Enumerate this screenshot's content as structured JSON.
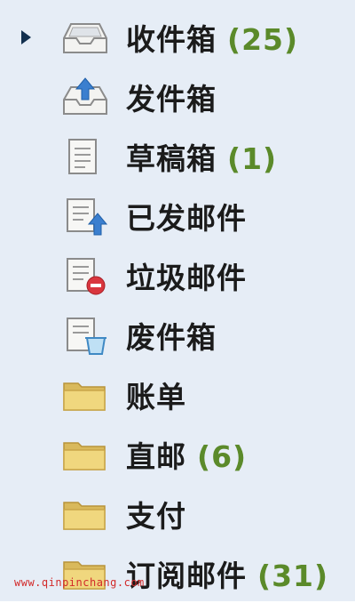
{
  "folders": [
    {
      "label": "收件箱",
      "count": "(25)",
      "icon": "inbox-icon",
      "selected": true
    },
    {
      "label": "发件箱",
      "count": "",
      "icon": "outbox-icon"
    },
    {
      "label": "草稿箱",
      "count": "(1)",
      "icon": "drafts-icon"
    },
    {
      "label": "已发邮件",
      "count": "",
      "icon": "sent-icon"
    },
    {
      "label": "垃圾邮件",
      "count": "",
      "icon": "junk-icon"
    },
    {
      "label": "废件箱",
      "count": "",
      "icon": "deleted-icon"
    },
    {
      "label": "账单",
      "count": "",
      "icon": "folder-icon"
    },
    {
      "label": "直邮",
      "count": "(6)",
      "icon": "folder-icon"
    },
    {
      "label": "支付",
      "count": "",
      "icon": "folder-icon"
    },
    {
      "label": "订阅邮件",
      "count": "(31)",
      "icon": "folder-icon"
    }
  ],
  "watermark": "www.qinpinchang.com",
  "colors": {
    "panel_bg": "#e6edf6",
    "count_color": "#5b8a2a",
    "selected_arrow": "#12304f",
    "watermark": "#d22a2a"
  }
}
